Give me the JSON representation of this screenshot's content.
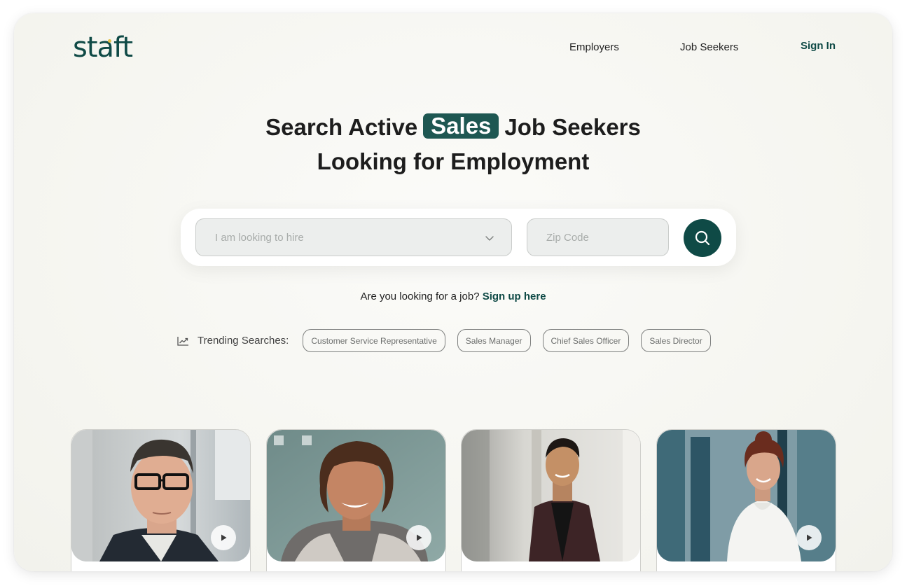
{
  "brand": {
    "logo_text": "staft",
    "primary_color": "#0f4a46",
    "accent_color": "#e3c24a"
  },
  "nav": {
    "employers": "Employers",
    "job_seekers": "Job Seekers",
    "sign_in": "Sign In"
  },
  "hero": {
    "line1_prefix": "Search Active",
    "highlight": "Sales",
    "line1_suffix": "Job Seekers",
    "line2": "Looking for Employment"
  },
  "search": {
    "role_placeholder": "I am looking to hire",
    "zip_placeholder": "Zip Code",
    "button_icon": "search-icon"
  },
  "signup": {
    "question": "Are you looking for a job?",
    "link": "Sign up here"
  },
  "trending": {
    "label": "Trending Searches:",
    "icon": "trending-up-icon",
    "chips": [
      "Customer Service Representative",
      "Sales Manager",
      "Chief Sales Officer",
      "Sales Director"
    ]
  },
  "candidates": [
    {
      "photo": "man-with-glasses",
      "play_icon": "play-icon"
    },
    {
      "photo": "woman-curly-hair",
      "play_icon": "play-icon"
    },
    {
      "photo": "man-dark-suit",
      "play_icon": "play-icon"
    },
    {
      "photo": "woman-white-blouse",
      "play_icon": "play-icon"
    }
  ]
}
